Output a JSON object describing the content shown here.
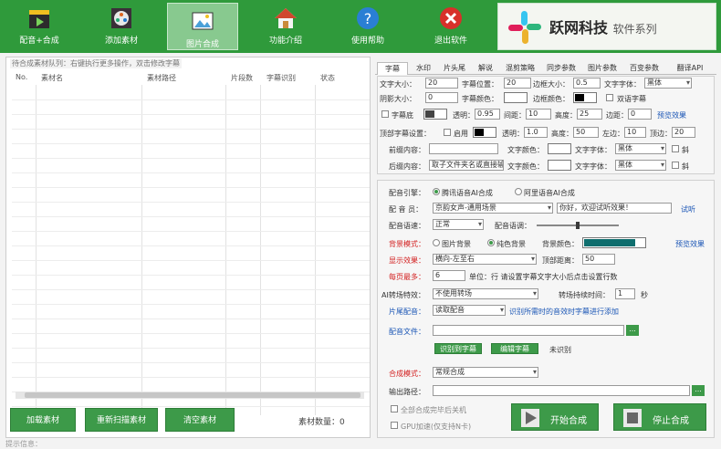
{
  "toolbar": {
    "items": [
      {
        "label": "配音+合成",
        "icon": "clapper-icon"
      },
      {
        "label": "添加素材",
        "icon": "film-reel-icon"
      },
      {
        "label": "图片合成",
        "icon": "image-icon"
      },
      {
        "label": "功能介绍",
        "icon": "home-icon"
      },
      {
        "label": "使用帮助",
        "icon": "question-icon"
      },
      {
        "label": "退出软件",
        "icon": "close-icon"
      }
    ],
    "brand": {
      "name": "跃网科技",
      "suffix": "软件系列"
    }
  },
  "queue": {
    "title": "待合成素材队列：右键执行更多操作，双击修改字幕",
    "columns": [
      "No.",
      "素材名",
      "素材路径",
      "片段数",
      "字幕识别",
      "状态"
    ],
    "rows": []
  },
  "left_buttons": {
    "add": "加载素材",
    "rescan": "重新扫描素材",
    "clear": "清空素材"
  },
  "material_count": {
    "label": "素材数量：",
    "value": "0"
  },
  "tabs": [
    "字幕",
    "水印",
    "片头尾",
    "解说",
    "混剪策略",
    "同步参数",
    "图片参数",
    "百变参数",
    "翻译API"
  ],
  "active_tab": "字幕",
  "subtitle": {
    "font_size_label": "文字大小：",
    "font_size": "20",
    "position_label": "字幕位置：",
    "position": "20",
    "border_size_label": "边框大小：",
    "border_size": "0.5",
    "font_label": "文字字体：",
    "font": "黑体",
    "shadow_label": "阴影大小：",
    "shadow": "0",
    "color_label": "字幕颜色：",
    "border_color_label": "边框颜色：",
    "bilingual_label": "双语字幕",
    "bg_label": "字幕底",
    "alpha_label": "透明：",
    "alpha": "0.95",
    "spacing_label": "间距：",
    "spacing": "10",
    "height_label": "高度：",
    "height": "25",
    "corner_label": "边距：",
    "corner": "0",
    "preview_label": "预览效果",
    "head_label": "顶部字幕设置：",
    "enable_label": "启用",
    "alpha2": "1.0",
    "height2_label": "高度：",
    "height2": "50",
    "left_label": "左边：",
    "left": "10",
    "top_label": "顶边：",
    "top": "20",
    "pre_label": "前缀内容：",
    "pre_value": "",
    "text_color_label": "文字颜色：",
    "text_font_label": "文字字体：",
    "text_font": "黑体",
    "italic_label": "斜",
    "suffix_label": "后缀内容：",
    "suffix_value": "取子文件夹名或直接输入",
    "text_font2": "黑体"
  },
  "voice": {
    "engine_label": "配音引擎：",
    "engine_opt1": "腾讯语音AI合成",
    "engine_opt2": "阿里语音AI合成",
    "speaker_label": "配 音 员：",
    "speaker": "京韵女声-通用场景",
    "test_text": "你好，欢迎试听效果！",
    "try_label": "试听",
    "speed_label": "配音语速：",
    "speed": "正常",
    "pitch_label": "配音语调：",
    "bg_mode_label": "背景模式：",
    "bg_opt1": "图片背景",
    "bg_opt2": "纯色背景",
    "bg_color_label": "背景颜色：",
    "bg_color": "#0f6e6e",
    "bg_preview": "预览效果",
    "effect_label": "显示效果：",
    "effect": "横向-左至右",
    "top_margin_label": "顶部距离：",
    "top_margin": "50",
    "lines_label": "每页最多：",
    "lines": "6",
    "lines_hint": "单位：行 请设置字幕文字大小后点击设置行数",
    "transition_label": "AI转场特效：",
    "transition": "不使用转场",
    "transition_time_label": "转场持续时间：",
    "transition_time": "1",
    "sec": "秒",
    "head_tail_label": "片尾配音：",
    "head_tail": "读取配音",
    "head_tail_hint": "识别所需时的音效时字幕进行添加",
    "audio_file_label": "配音文件：",
    "recog_btn": "识别到字幕",
    "edit_btn": "编辑字幕",
    "recog_status": "未识别",
    "mode_label": "合成模式：",
    "mode": "常规合成",
    "output_label": "输出路径：",
    "shutdown_label": "全部合成完毕后关机",
    "gpu_label": "GPU加速(仅支持N卡)",
    "start_btn": "开始合成",
    "stop_btn": "停止合成"
  },
  "status_bar": "提示信息："
}
